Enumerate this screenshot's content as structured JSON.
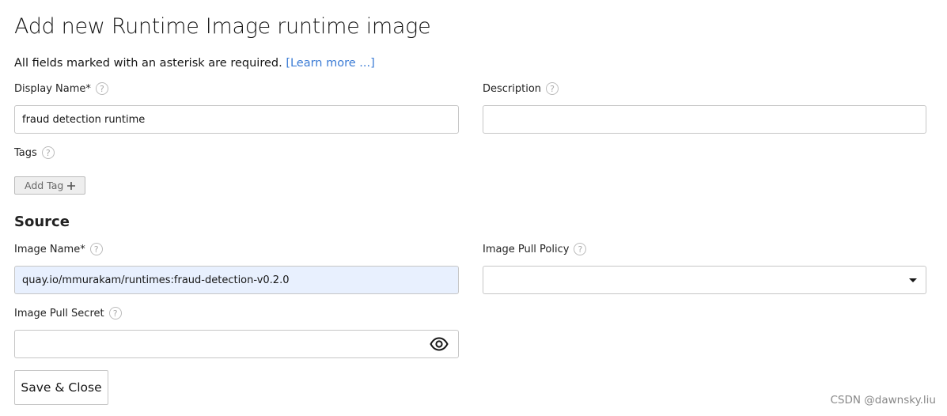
{
  "page": {
    "title": "Add new Runtime Image runtime image",
    "intro": "All fields marked with an asterisk are required.",
    "learn_more": "[Learn more ...]"
  },
  "fields": {
    "display_name": {
      "label": "Display Name*",
      "value": "fraud detection runtime",
      "help": "?"
    },
    "description": {
      "label": "Description",
      "value": "",
      "help": "?"
    },
    "tags": {
      "label": "Tags",
      "help": "?",
      "add_label": "Add Tag",
      "add_icon": "plus-icon"
    }
  },
  "source": {
    "heading": "Source",
    "image_name": {
      "label": "Image Name*",
      "value": "quay.io/mmurakam/runtimes:fraud-detection-v0.2.0",
      "help": "?"
    },
    "pull_policy": {
      "label": "Image Pull Policy",
      "value": "",
      "help": "?",
      "icon": "caret-down-icon"
    },
    "pull_secret": {
      "label": "Image Pull Secret",
      "value": "",
      "help": "?",
      "icon": "eye-icon"
    }
  },
  "actions": {
    "save_close": "Save & Close"
  },
  "watermark": "CSDN @dawnsky.liu",
  "colors": {
    "link": "#3a7bd5",
    "autofill_bg": "#e8f0fe"
  }
}
